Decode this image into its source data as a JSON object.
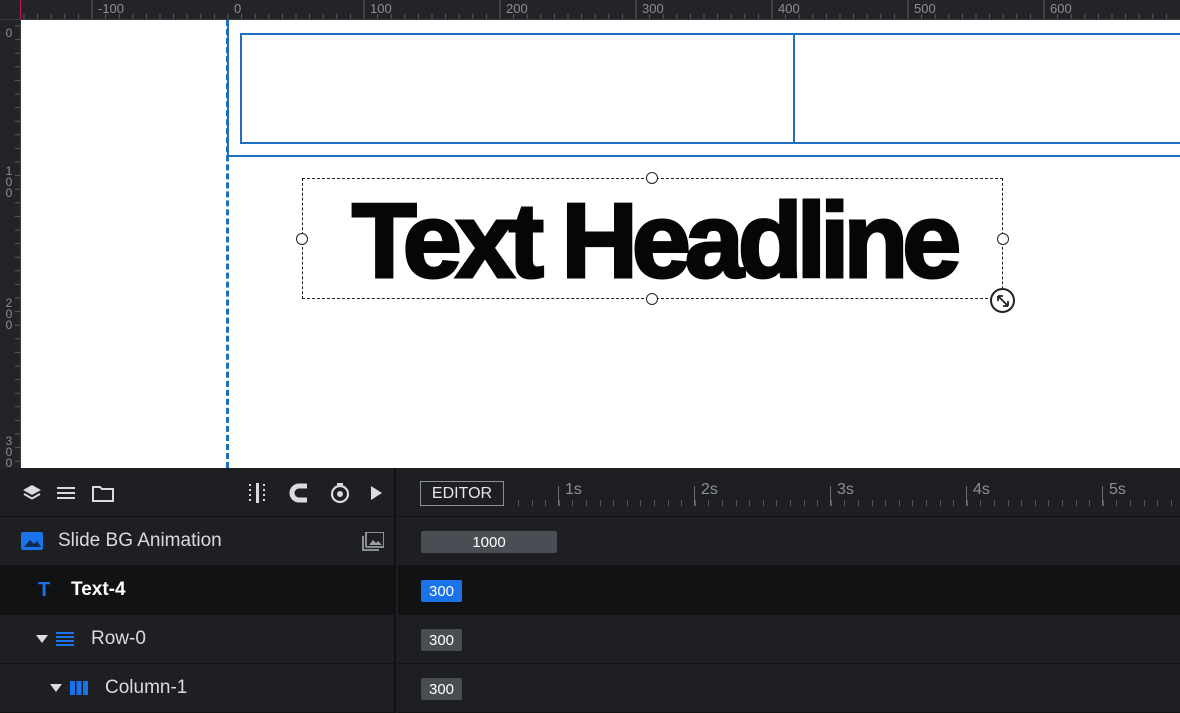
{
  "ruler": {
    "h_labels": [
      "-100",
      "0",
      "100",
      "200",
      "300",
      "400",
      "500",
      "600"
    ],
    "v_labels": [
      "0",
      "1\n0\n0",
      "2\n0\n0",
      "3\n0\n0"
    ]
  },
  "canvas": {
    "headline": "Text Headline"
  },
  "toolbar": {
    "icons": [
      "layers-icon",
      "list-icon",
      "folder-icon",
      "grid-icon",
      "magnet-icon",
      "timer-icon",
      "play-icon"
    ]
  },
  "layers": [
    {
      "name": "Slide BG Animation",
      "icon": "image-icon",
      "duration": "1000"
    },
    {
      "name": "Text-4",
      "icon": "text-icon",
      "duration": "300"
    },
    {
      "name": "Row-0",
      "icon": "row-icon",
      "duration": "300"
    },
    {
      "name": "Column-1",
      "icon": "column-icon",
      "duration": "300"
    }
  ],
  "timeline": {
    "editor_label": "EDITOR",
    "seconds": [
      "1s",
      "2s",
      "3s",
      "4s",
      "5s"
    ]
  },
  "colors": {
    "accent": "#1f6fbf",
    "selected_pill": "#1a73e8",
    "pill": "#4a4d54",
    "canvas_bg": "#ffffff",
    "panel_bg": "#1e1f22"
  }
}
